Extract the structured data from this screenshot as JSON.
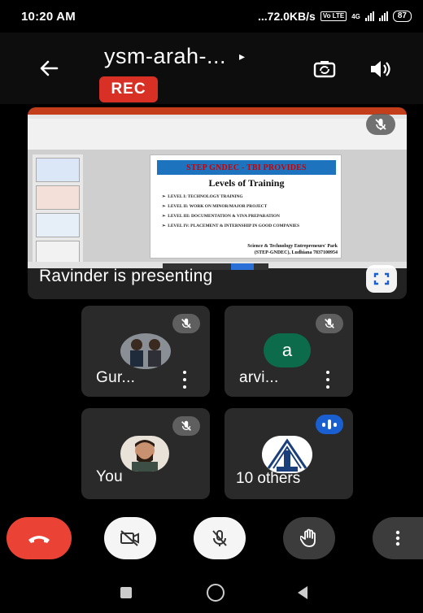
{
  "status_bar": {
    "time": "10:20 AM",
    "network_speed": "...72.0KB/s",
    "volte_badge": "Vo LTE",
    "network_type": "4G",
    "battery": "87"
  },
  "header": {
    "meeting_title": "ysm-arah-...",
    "recording_badge": "REC",
    "icons": [
      "back-arrow-icon",
      "switch-camera-icon",
      "speaker-icon"
    ]
  },
  "presentation": {
    "slide": {
      "banner": "STEP GNDEC - TBI PROVIDES",
      "heading": "Levels of Training",
      "items": [
        "LEVEL I: TECHNOLOGY TRAINING",
        "LEVEL II: WORK ON MINOR/MAJOR PROJECT",
        "LEVEL III: DOCUMENTATION & VIVA PREPARATION",
        "LEVEL IV: PLACEMENT & INTERNSHIP IN GOOD COMPANIES"
      ],
      "footer_line1": "Science & Technology Entrepreneurs' Park",
      "footer_line2": "(STEP-GNDEC), Ludhiana 7837100954"
    },
    "presenter_label": "Ravinder is presenting"
  },
  "participants": [
    {
      "name": "Gur...",
      "muted": true
    },
    {
      "name": "arvi...",
      "muted": true,
      "avatar_letter": "a",
      "avatar_color": "#0b6b4a"
    },
    {
      "name": "You",
      "muted": true
    },
    {
      "name": "10 others",
      "speaking": true
    }
  ],
  "controls": {
    "end_call_color": "#ea4335",
    "buttons": [
      "end-call",
      "camera-off",
      "mic-off",
      "raise-hand",
      "more-options"
    ]
  },
  "colors": {
    "background": "#000000",
    "tile": "#2a2a2a",
    "rec": "#d93025",
    "speaking": "#1a5fd0"
  }
}
